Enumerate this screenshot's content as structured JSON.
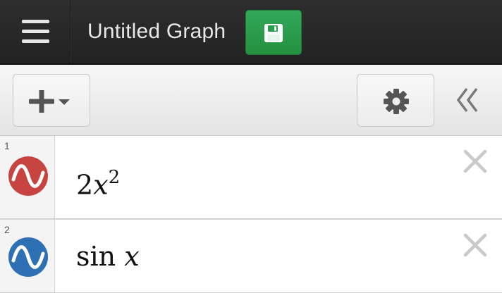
{
  "header": {
    "title": "Untitled Graph",
    "save_icon": "floppy-disk-icon",
    "menu_icon": "hamburger-menu-icon"
  },
  "toolbar": {
    "add_icon": "plus-icon",
    "add_dropdown_icon": "caret-down-icon",
    "settings_icon": "gear-icon",
    "collapse_icon": "double-chevron-left-icon"
  },
  "expressions": [
    {
      "index": "1",
      "color": "#c74440",
      "coefficient": "2",
      "variable": "x",
      "exponent": "2"
    },
    {
      "index": "2",
      "color": "#2d70b3",
      "function": "sin",
      "variable": "x"
    }
  ],
  "colors": {
    "topbar": "#2a2a2a",
    "save_button": "#2f9e4f",
    "expr_red": "#c74440",
    "expr_blue": "#2d70b3"
  }
}
